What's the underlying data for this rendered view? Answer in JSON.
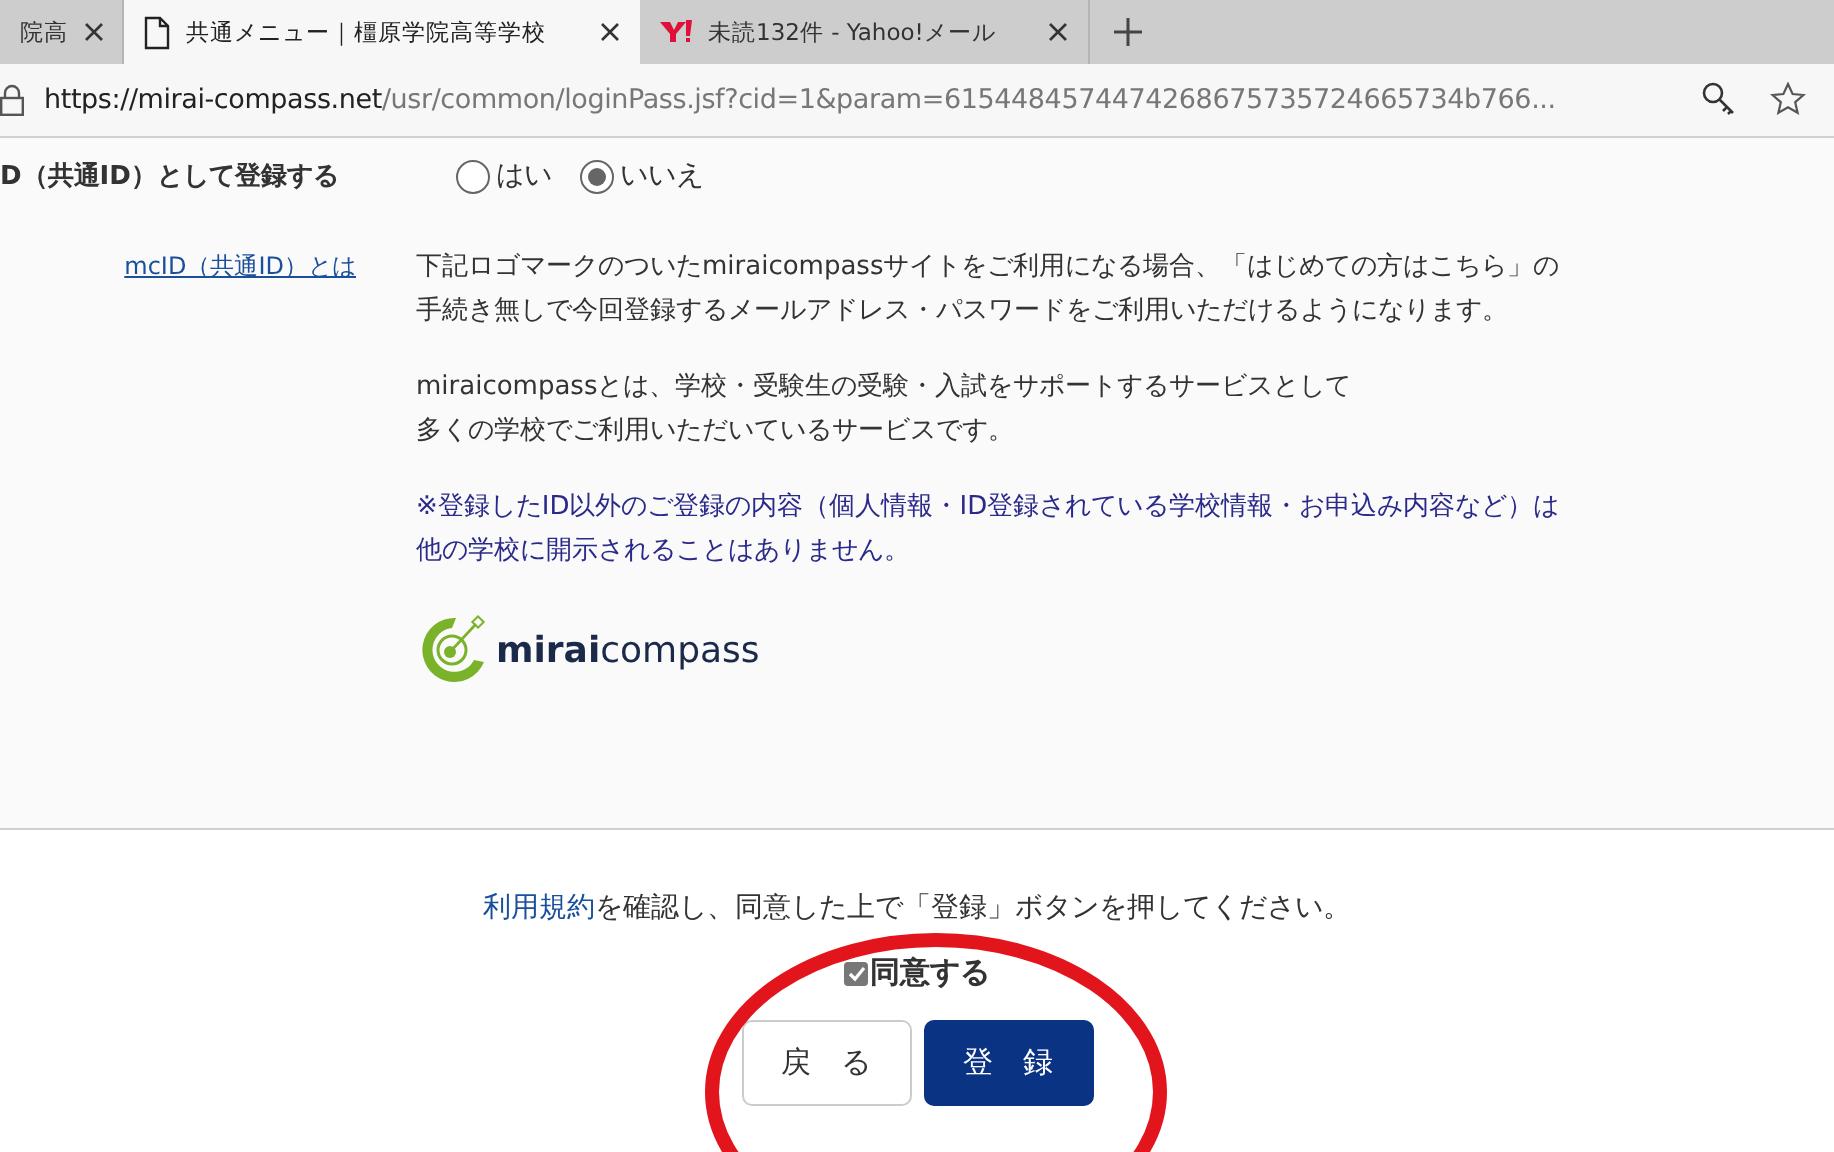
{
  "browser": {
    "tabs": [
      {
        "title": "院高",
        "selected": false,
        "kind": "cut"
      },
      {
        "title": "共通メニュー｜橿原学院高等学校",
        "selected": true,
        "kind": "page"
      },
      {
        "title": "未読132件 - Yahoo!メール",
        "selected": false,
        "kind": "yahoo"
      }
    ],
    "address": {
      "host": "https://mirai-compass.net",
      "path": "/usr/common/loginPass.jsf?cid=1&param=6154484574474268675735724665734b766..."
    }
  },
  "register_row": {
    "label": "D（共通ID）として登録する",
    "options": [
      {
        "label": "はい",
        "selected": false
      },
      {
        "label": "いいえ",
        "selected": true
      }
    ]
  },
  "info": {
    "link": "mcID（共通ID）とは",
    "paragraphs": [
      {
        "kind": "plain",
        "lines": [
          "下記ロゴマークのついたmiraicompassサイトをご利用になる場合、「はじめての方はこちら」の",
          "手続き無しで今回登録するメールアドレス・パスワードをご利用いただけるようになります。"
        ]
      },
      {
        "kind": "plain",
        "lines": [
          "miraicompassとは、学校・受験生の受験・入試をサポートするサービスとして",
          "多くの学校でご利用いただいているサービスです。"
        ]
      },
      {
        "kind": "notice",
        "lines": [
          "※登録したID以外のご登録の内容（個人情報・ID登録されている学校情報・お申込み内容など）は",
          "他の学校に開示されることはありません。"
        ]
      }
    ],
    "logo": {
      "bold": "mirai",
      "rest": "compass"
    }
  },
  "footer": {
    "terms_link": "利用規約",
    "sentence": "を確認し、同意した上で「登録」ボタンを押してください。",
    "agree": {
      "label": "同意する",
      "checked": true
    },
    "buttons": [
      {
        "label": "戻　る",
        "kind": "secondary"
      },
      {
        "label": "登　録",
        "kind": "primary"
      }
    ]
  }
}
